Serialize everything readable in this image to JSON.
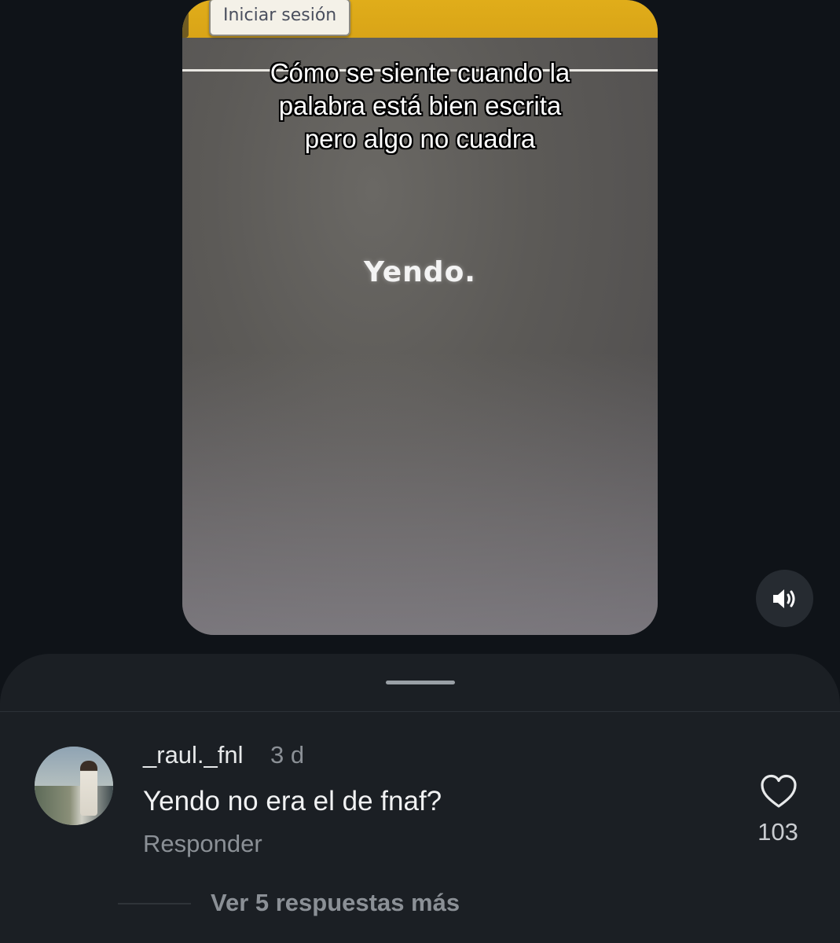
{
  "video": {
    "signin_label": "Iniciar sesión",
    "caption_lines": [
      "Cómo se siente cuando la",
      "palabra está bien escrita",
      "pero algo no cuadra"
    ],
    "center_word": "Yendo."
  },
  "controls": {
    "sound_icon": "speaker-volume-icon"
  },
  "comment": {
    "username": "_raul._fnl",
    "timestamp": "3 d",
    "text": "Yendo no era el de fnaf?",
    "reply_label": "Responder",
    "like_icon": "heart-outline-icon",
    "like_count": "103",
    "view_replies_label": "Ver 5 respuestas más"
  },
  "colors": {
    "background": "#0f1318",
    "sheet": "#1b1f24",
    "video_topbar": "#d9a417",
    "muted_text": "#8b9096"
  }
}
